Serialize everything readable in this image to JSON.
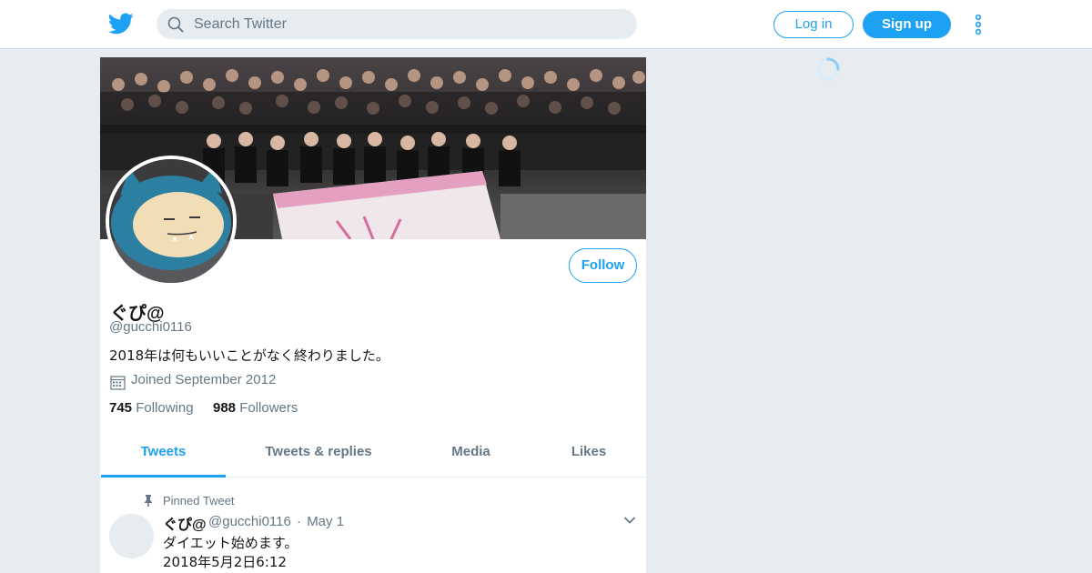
{
  "colors": {
    "accent": "#1da1f2",
    "background": "#e6ecf0",
    "secondary_text": "#657786",
    "primary_text": "#14171a"
  },
  "header": {
    "logo_icon": "twitter-bird-icon",
    "search": {
      "placeholder": "Search Twitter",
      "icon": "search-icon"
    },
    "login_label": "Log in",
    "signup_label": "Sign up",
    "more_icon": "more-vertical-icon"
  },
  "profile": {
    "banner_image": "group-photo-banner",
    "avatar_image": "plush-avatar",
    "follow_label": "Follow",
    "display_name": "ぐぴ@",
    "handle": "@gucchi0116",
    "bio": "2018年は何もいいことがなく終わりました。",
    "joined_icon": "calendar-icon",
    "joined": "Joined September 2012",
    "following_count": "745",
    "following_label": "Following",
    "followers_count": "988",
    "followers_label": "Followers"
  },
  "tabs": [
    {
      "label": "Tweets",
      "active": true
    },
    {
      "label": "Tweets & replies",
      "active": false
    },
    {
      "label": "Media",
      "active": false
    },
    {
      "label": "Likes",
      "active": false
    }
  ],
  "pinned_tweet": {
    "pinned_label": "Pinned Tweet",
    "pin_icon": "pin-icon",
    "author_name": "ぐぴ@",
    "author_handle": "@gucchi0116",
    "separator": "·",
    "date": "May 1",
    "text_line1": "ダイエット始めます。",
    "text_line2": "2018年5月2日6:12",
    "caret_icon": "chevron-down-icon"
  },
  "loading_icon": "loading-spinner-icon"
}
